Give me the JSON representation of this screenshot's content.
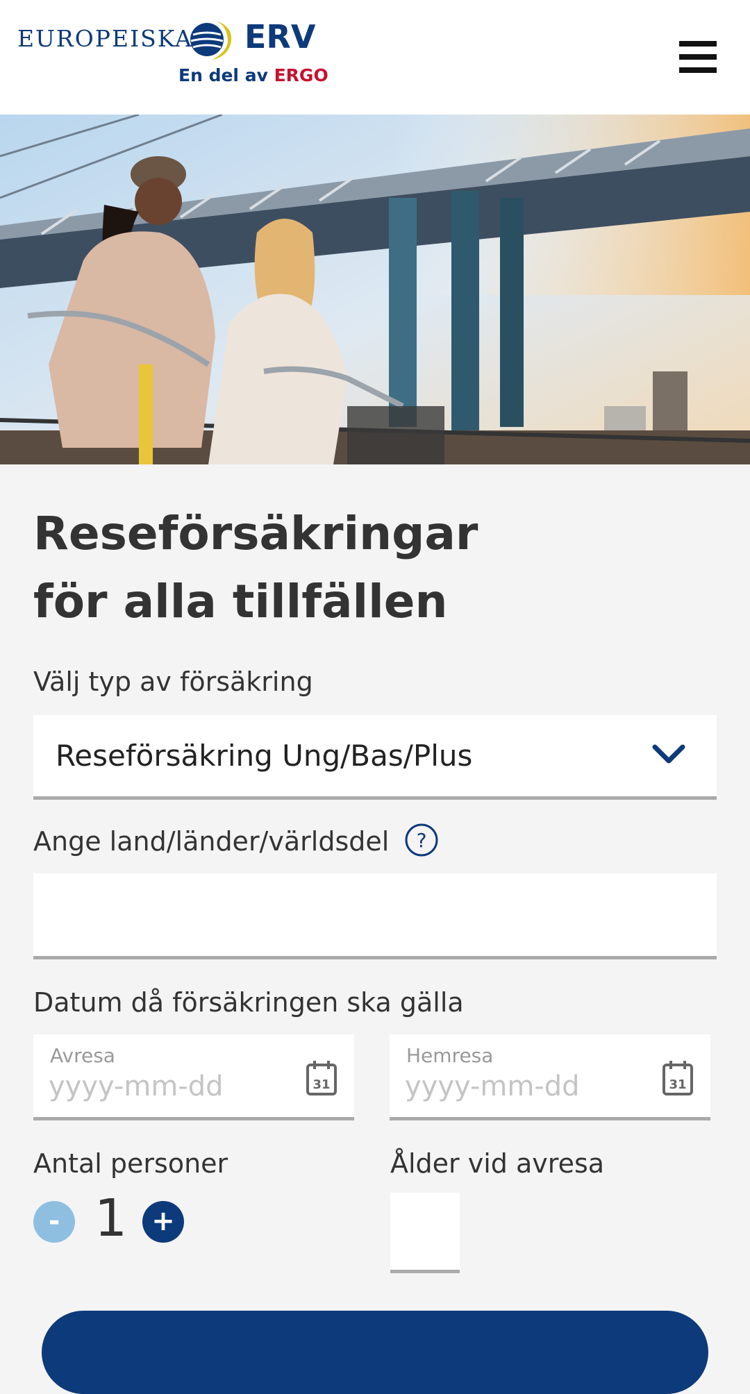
{
  "header": {
    "logo_word": "EUROPEISKA",
    "logo_brand": "ERV",
    "logo_tagline_prefix": "En del av",
    "logo_tagline_brand": "ERGO",
    "menu_icon": "hamburger-menu-icon"
  },
  "hero": {
    "image_alt": "Two women with bicycles under a bridge"
  },
  "form": {
    "title_line1": "Reseförsäkringar",
    "title_line2": "för alla tillfällen",
    "type_label": "Välj typ av försäkring",
    "type_value": "Reseförsäkring Ung/Bas/Plus",
    "destination_label": "Ange land/länder/världsdel",
    "destination_value": "",
    "date_label": "Datum då försäkringen ska gälla",
    "departure_label": "Avresa",
    "departure_placeholder": "yyyy-mm-dd",
    "return_label": "Hemresa",
    "return_placeholder": "yyyy-mm-dd",
    "calendar_day": "31",
    "persons_label": "Antal personer",
    "persons_count": "1",
    "minus_label": "-",
    "plus_label": "+",
    "age_label": "Ålder vid avresa",
    "age_value": ""
  },
  "colors": {
    "brand_blue": "#0d3a7a",
    "ergo_red": "#c8102e",
    "minus_disabled": "#8fbfe0",
    "background": "#f4f4f4"
  }
}
